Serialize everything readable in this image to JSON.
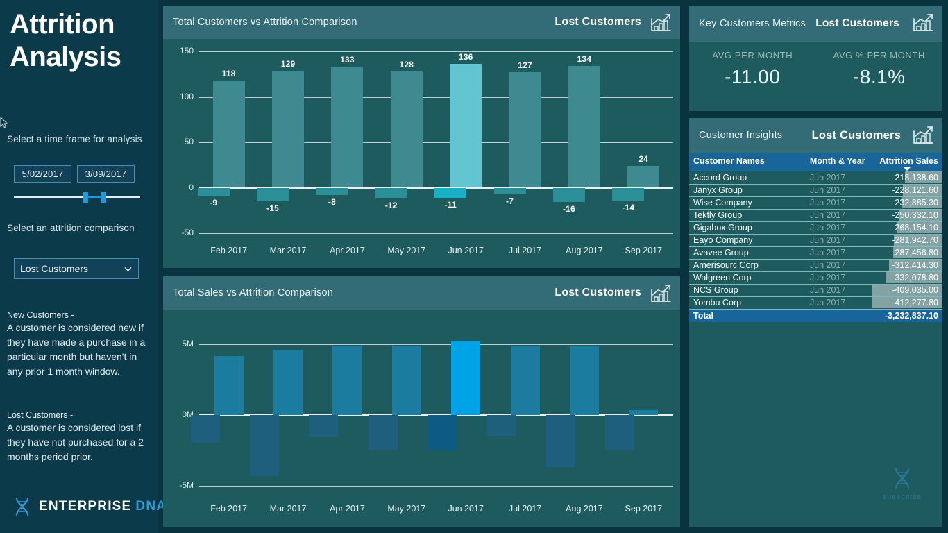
{
  "sidebar": {
    "title_line1": "Attrition",
    "title_line2": "Analysis",
    "timeframe_label": "Select a time frame for analysis",
    "date_start": "5/02/2017",
    "date_end": "3/09/2017",
    "comparison_label": "Select an attrition comparison",
    "dropdown_value": "Lost Customers",
    "chevron_icon": "chevron-down-icon",
    "definitions": [
      {
        "head": "New Customers -",
        "body": "A customer is considered new if they have made a purchase in a particular month but haven't in any prior 1 month window."
      },
      {
        "head": "Lost Customers -",
        "body": "A customer is considered lost if they have not purchased for a 2 months period prior."
      }
    ],
    "logo_primary": "ENTERPRISE",
    "logo_secondary": "DNA",
    "logo_icon": "dna-helix-icon"
  },
  "chart1": {
    "title": "Total Customers vs Attrition Comparison",
    "metric": "Lost Customers",
    "icon": "growth-chart-icon"
  },
  "chart2": {
    "title": "Total Sales vs Attrition Comparison",
    "metric": "Lost Customers",
    "icon": "growth-chart-icon"
  },
  "metrics": {
    "title": "Key Customers Metrics",
    "metric": "Lost Customers",
    "icon": "growth-chart-icon",
    "cells": [
      {
        "caption": "AVG PER MONTH",
        "value": "-11.00"
      },
      {
        "caption": "AVG % PER MONTH",
        "value": "-8.1%"
      }
    ]
  },
  "insights": {
    "title": "Customer Insights",
    "metric": "Lost Customers",
    "icon": "growth-chart-icon",
    "columns": [
      "Customer Names",
      "Month & Year",
      "Attrition Sales"
    ],
    "sort_column": "Attrition Sales",
    "sort_icon": "sort-descending-caret",
    "rows": [
      {
        "name": "Accord Group",
        "month": "Jun 2017",
        "sales": "-218,138.60",
        "value": -218138.6
      },
      {
        "name": "Janyx Group",
        "month": "Jun 2017",
        "sales": "-228,121.60",
        "value": -228121.6
      },
      {
        "name": "Wise Company",
        "month": "Jun 2017",
        "sales": "-232,885.30",
        "value": -232885.3
      },
      {
        "name": "Tekfly Group",
        "month": "Jun 2017",
        "sales": "-250,332.10",
        "value": -250332.1
      },
      {
        "name": "Gigabox Group",
        "month": "Jun 2017",
        "sales": "-268,154.10",
        "value": -268154.1
      },
      {
        "name": "Eayo Company",
        "month": "Jun 2017",
        "sales": "-281,942.70",
        "value": -281942.7
      },
      {
        "name": "Avavee Group",
        "month": "Jun 2017",
        "sales": "-287,456.80",
        "value": -287456.8
      },
      {
        "name": "Amerisourc Corp",
        "month": "Jun 2017",
        "sales": "-312,414.30",
        "value": -312414.3
      },
      {
        "name": "Walgreen Corp",
        "month": "Jun 2017",
        "sales": "-332,078.80",
        "value": -332078.8
      },
      {
        "name": "NCS Group",
        "month": "Jun 2017",
        "sales": "-409,035.00",
        "value": -409035.0
      },
      {
        "name": "Yombu Corp",
        "month": "Jun 2017",
        "sales": "-412,277.80",
        "value": -412277.8
      }
    ],
    "total_label": "Total",
    "total_value": "-3,232,837.10"
  },
  "watermark": {
    "text": "SUBSCRIBE",
    "icon": "dna-helix-icon"
  },
  "colors": {
    "sidebar_bg": "#0b3a4a",
    "panel_bg": "#1e5b5e",
    "panel_head": "#336b76",
    "bar_teal": "#3d8a91",
    "bar_teal_highlight": "#62c4cf",
    "bar_teal_negative": "#2a8f96",
    "bar_blue": "#1b7ca0",
    "bar_blue_highlight": "#00a3e8",
    "bar_blue_negative": "#1f5f7e",
    "bar_blue_negative_highlight": "#0d5b85",
    "table_header": "#18659b",
    "accent": "#1e9ad6"
  },
  "chart_data": [
    {
      "type": "bar",
      "title": "Total Customers vs Attrition Comparison",
      "xlabel": "",
      "ylabel": "",
      "categories": [
        "Feb 2017",
        "Mar 2017",
        "Apr 2017",
        "May 2017",
        "Jun 2017",
        "Jul 2017",
        "Aug 2017",
        "Sep 2017"
      ],
      "ylim": [
        -50,
        150
      ],
      "yticks": [
        150,
        100,
        50,
        0,
        -50
      ],
      "grid": true,
      "legend": "none",
      "series": [
        {
          "name": "Total Customers",
          "values": [
            118,
            129,
            133,
            128,
            136,
            127,
            134,
            24
          ]
        },
        {
          "name": "Lost Customers",
          "values": [
            -9,
            -15,
            -8,
            -12,
            -11,
            -7,
            -16,
            -14
          ]
        }
      ],
      "highlight_category": "Jun 2017",
      "data_labels": [
        "118",
        "129",
        "133",
        "128",
        "136",
        "127",
        "134",
        "24",
        "-9",
        "-15",
        "-8",
        "-12",
        "-11",
        "-7",
        "-16",
        "-14"
      ]
    },
    {
      "type": "bar",
      "title": "Total Sales vs Attrition Comparison",
      "xlabel": "",
      "ylabel": "",
      "categories": [
        "Feb 2017",
        "Mar 2017",
        "Apr 2017",
        "May 2017",
        "Jun 2017",
        "Jul 2017",
        "Aug 2017",
        "Sep 2017"
      ],
      "ylim": [
        -5000000,
        5000000
      ],
      "yticks": [
        "5M",
        "0M",
        "-5M"
      ],
      "grid": true,
      "legend": "none",
      "series": [
        {
          "name": "Total Sales",
          "values": [
            4150000,
            4600000,
            4900000,
            4920000,
            5200000,
            4920000,
            4850000,
            350000
          ]
        },
        {
          "name": "Attrition Sales",
          "values": [
            -1950000,
            -4300000,
            -1500000,
            -2450000,
            -2500000,
            -1450000,
            -3700000,
            -2450000
          ]
        }
      ],
      "highlight_category": "Jun 2017",
      "data_labels": []
    }
  ]
}
